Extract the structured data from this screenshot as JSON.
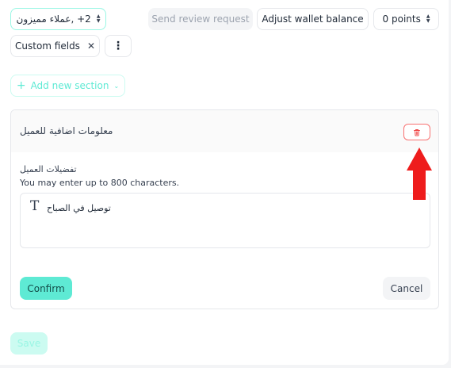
{
  "toolbar": {
    "groups_select_value": "2+ ,عملاء مميزون",
    "send_review_label": "Send review request",
    "adjust_wallet_label": "Adjust wallet balance",
    "points_value": "0 points",
    "custom_fields_label": "Custom fields",
    "more_icon": "vertical-ellipsis-icon"
  },
  "add_section": {
    "label": "Add new section",
    "icon": "plus-icon"
  },
  "section": {
    "title": "معلومات اضافية للعميل",
    "delete_icon": "trash-icon",
    "field_label": "تفضيلات العميل",
    "field_hint": "You may enter up to 800 characters.",
    "field_value": "توصيل في الصباح",
    "field_icon": "text-type-icon",
    "confirm_label": "Confirm",
    "cancel_label": "Cancel"
  },
  "footer": {
    "save_label": "Save"
  },
  "annotation": {
    "arrow_icon": "red-up-arrow-icon"
  },
  "colors": {
    "accent": "#5eead4",
    "accent_light": "#ccfbf1",
    "danger": "#f87171",
    "arrow": "#ee1c1c"
  }
}
